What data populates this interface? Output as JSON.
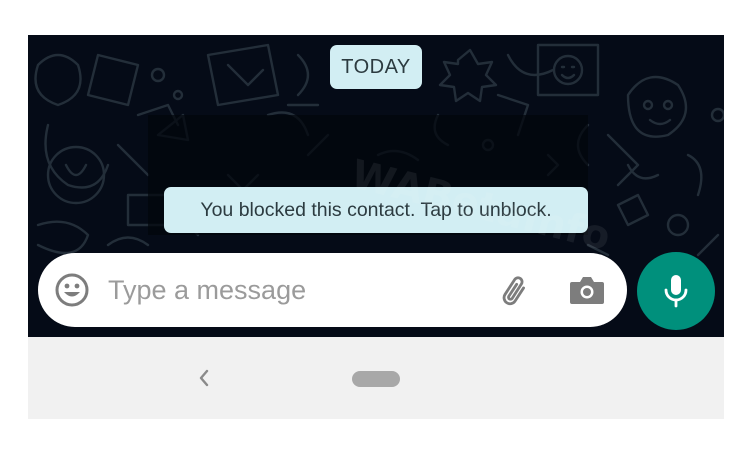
{
  "chat": {
    "date_label": "TODAY",
    "system_message": "You blocked this contact. Tap to unblock.",
    "watermark": "WABetaInfo"
  },
  "composer": {
    "placeholder": "Type a message",
    "emoji_icon": "emoji-icon",
    "attach_icon": "paperclip-icon",
    "camera_icon": "camera-icon",
    "mic_icon": "microphone-icon"
  },
  "navigation": {
    "back_icon": "chevron-left-icon",
    "home_icon": "home-pill"
  },
  "colors": {
    "chat_background": "#050b17",
    "chip_background": "#d2eef3",
    "accent": "#00907c",
    "nav_background": "#f1f1f1"
  }
}
